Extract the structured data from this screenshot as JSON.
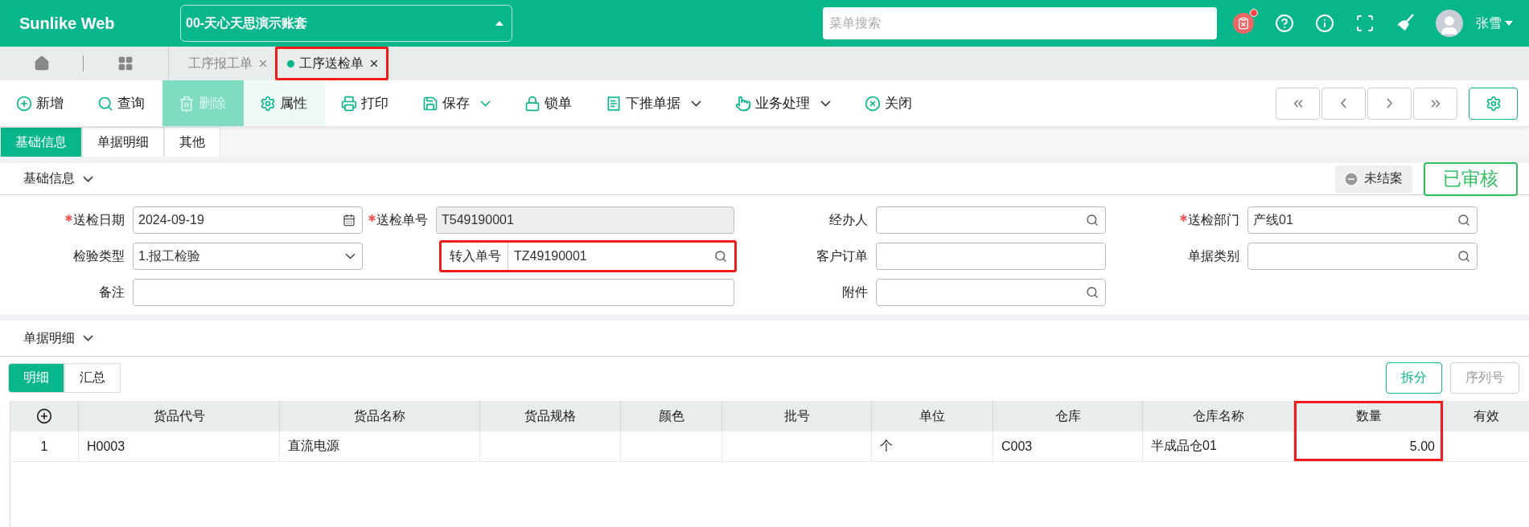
{
  "header": {
    "logo": "Sunlike Web",
    "account": "00-天心天思演示账套",
    "search": {
      "placeholder": "菜单搜索"
    },
    "user": "张雪"
  },
  "nav_tabs": [
    {
      "label": "工序报工单",
      "selected": false,
      "highlighted": false
    },
    {
      "label": "工序送检单",
      "selected": true,
      "highlighted": true
    }
  ],
  "toolbar": [
    {
      "label": "新增",
      "disabled": false,
      "selected": false,
      "dropdown": false
    },
    {
      "label": "查询",
      "disabled": false,
      "selected": false,
      "dropdown": false
    },
    {
      "label": "删除",
      "disabled": true,
      "selected": false,
      "dropdown": false
    },
    {
      "label": "属性",
      "disabled": false,
      "selected": true,
      "dropdown": false
    },
    {
      "label": "打印",
      "disabled": false,
      "selected": false,
      "dropdown": false
    },
    {
      "label": "保存",
      "disabled": false,
      "selected": false,
      "dropdown": true
    },
    {
      "label": "锁单",
      "disabled": false,
      "selected": false,
      "dropdown": false
    },
    {
      "label": "下推单据",
      "disabled": false,
      "selected": false,
      "dropdown": true
    },
    {
      "label": "业务处理",
      "disabled": false,
      "selected": false,
      "dropdown": true
    },
    {
      "label": "关闭",
      "disabled": false,
      "selected": false,
      "dropdown": false
    }
  ],
  "form_tabs": [
    {
      "label": "基础信息",
      "selected": true
    },
    {
      "label": "单据明细",
      "selected": false
    },
    {
      "label": "其他",
      "selected": false
    }
  ],
  "basic_info": {
    "title": "基础信息",
    "status": "未结案",
    "stamp": "已审核",
    "rows": [
      [
        {
          "label": "送检日期",
          "value": "2024-09-19",
          "kind": "date",
          "required": true,
          "highlighted": false
        },
        {
          "label": "送检单号",
          "value": "T549190001",
          "kind": "readonly",
          "required": true,
          "highlighted": false
        },
        {
          "label": "经办人",
          "kind": "lookup",
          "required": false,
          "highlighted": false
        },
        {
          "label": "送检部门",
          "value": "产线01",
          "kind": "lookup",
          "required": true,
          "highlighted": false
        }
      ],
      [
        {
          "label": "检验类型",
          "value": "1.报工检验",
          "kind": "select",
          "required": false,
          "highlighted": false
        },
        {
          "label": "转入单号",
          "value": "TZ49190001",
          "kind": "lookup",
          "required": false,
          "highlighted": true
        },
        {
          "label": "客户订单",
          "kind": "text",
          "required": false,
          "highlighted": false
        },
        {
          "label": "单据类别",
          "kind": "lookup",
          "required": false,
          "highlighted": false
        }
      ],
      [
        {
          "label": "备注",
          "kind": "memo",
          "required": false,
          "highlighted": false
        },
        "",
        {
          "label": "附件",
          "kind": "lookup",
          "required": false,
          "highlighted": false
        }
      ]
    ]
  },
  "details": {
    "title": "单据明细",
    "tabs": [
      {
        "label": "明细",
        "selected": true
      },
      {
        "label": "汇总",
        "selected": false
      }
    ],
    "buttons": [
      {
        "label": "拆分",
        "disabled": false
      },
      {
        "label": "序列号",
        "disabled": true
      }
    ],
    "columns": [
      {
        "label": "货品代号",
        "highlighted": false
      },
      {
        "label": "货品名称",
        "highlighted": false
      },
      {
        "label": "货品规格",
        "highlighted": false
      },
      {
        "label": "颜色",
        "highlighted": false
      },
      {
        "label": "批号",
        "highlighted": false
      },
      {
        "label": "单位",
        "highlighted": false
      },
      {
        "label": "仓库",
        "highlighted": false
      },
      {
        "label": "仓库名称",
        "highlighted": false
      },
      {
        "label": "数量",
        "numeric": true,
        "highlighted": true
      },
      {
        "label": "有效",
        "highlighted": false
      }
    ],
    "rows": [
      {
        "no": "1",
        "cells": [
          "H0003",
          "直流电源",
          "",
          "",
          "",
          "个",
          "C003",
          "半成品仓01",
          "5.00",
          ""
        ]
      }
    ]
  }
}
